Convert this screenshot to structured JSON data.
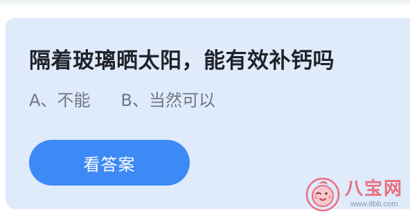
{
  "question": {
    "title": "隔着玻璃晒太阳，能有效补钙吗",
    "option_a": "A、不能",
    "option_b": "B、当然可以"
  },
  "actions": {
    "answer_label": "看答案"
  },
  "watermark": {
    "name": "八宝网",
    "url": "www.8bb.com"
  },
  "colors": {
    "card_background": "#dfeafb",
    "button": "#3d89f5",
    "question_text": "#1f2228",
    "option_text": "#6f7681",
    "watermark": "#e86f7e"
  }
}
